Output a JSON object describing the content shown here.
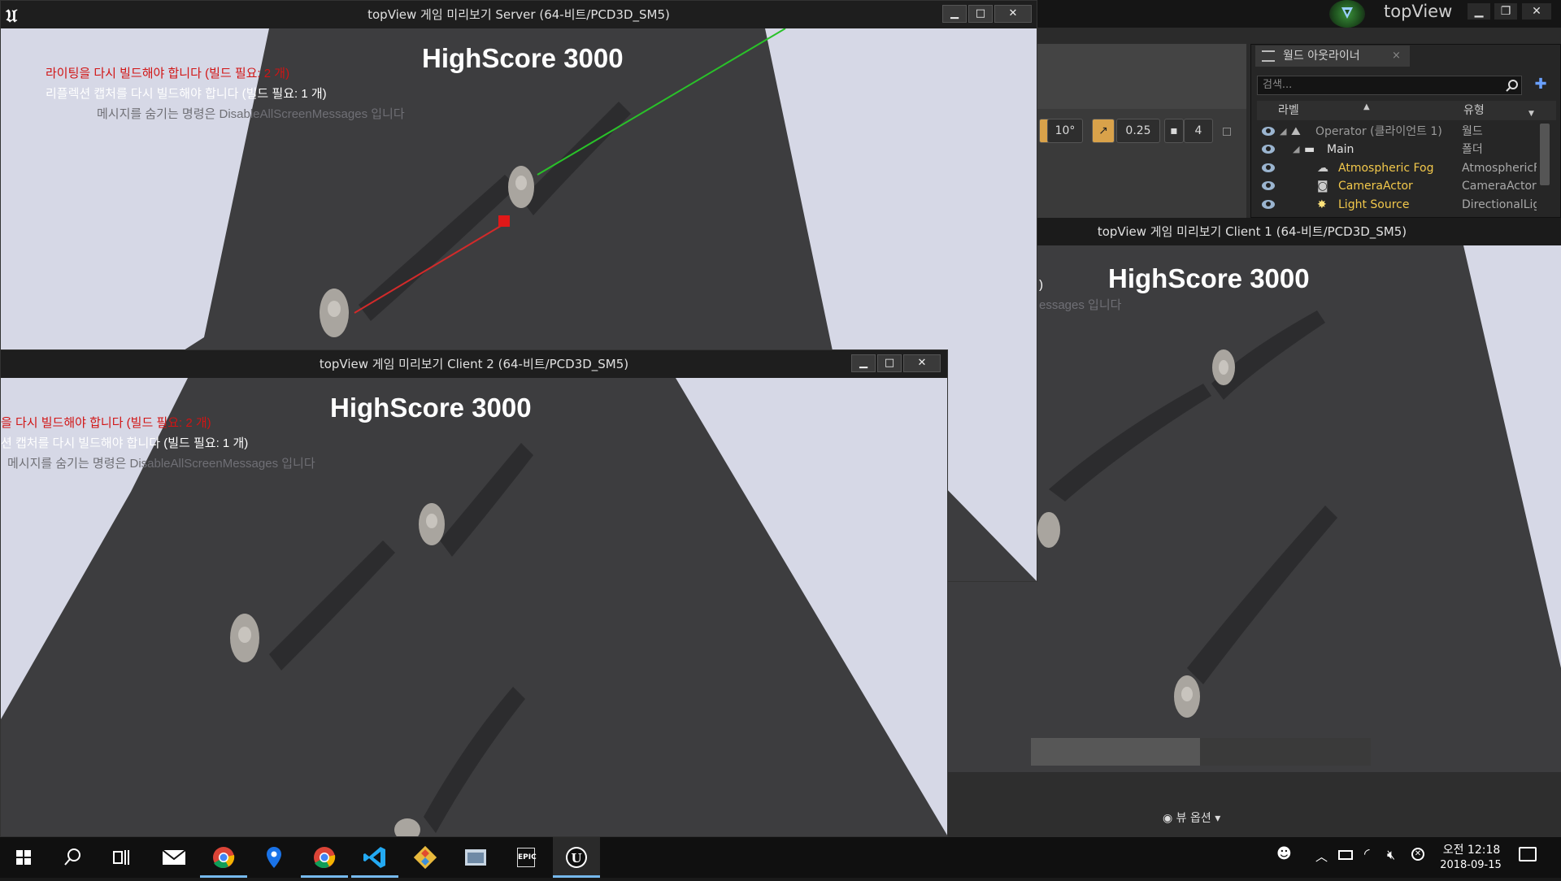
{
  "editor": {
    "app_name": "topView",
    "toolbar": {
      "rotation_snap": "10°",
      "scale_snap": "0.25",
      "camera_speed": "4"
    },
    "outliner": {
      "tab_label": "월드 아웃라이너",
      "search_placeholder": "검색...",
      "col_label": "라벨",
      "col_type": "유형",
      "rows": [
        {
          "label": "Operator (클라이언트 1)",
          "type": "월드",
          "color": "#9a9a9a"
        },
        {
          "label": "Main",
          "type": "폴더",
          "color": "#e0e0e0"
        },
        {
          "label": "Atmospheric Fog",
          "type": "AtmosphericF",
          "color": "#f2c84b"
        },
        {
          "label": "CameraActor",
          "type": "CameraActor",
          "color": "#f2c84b"
        },
        {
          "label": "Light Source",
          "type": "DirectionalLig",
          "color": "#f2c84b"
        }
      ]
    },
    "view_options": "뷰 옵션"
  },
  "server": {
    "title": "topView 게임 미리보기 Server (64-비트/PCD3D_SM5)",
    "score": "HighScore 3000",
    "msg_red": "라이팅을 다시 빌드해야 합니다 (빌드 필요: 2 개)",
    "msg_white": "리플렉션 캡처를 다시 빌드해야 합니다 (빌드 필요: 1 개)",
    "msg_gray": "메시지를 숨기는 명령은 DisableAllScreenMessages 입니다"
  },
  "client1": {
    "title": "topView 게임 미리보기 Client 1 (64-비트/PCD3D_SM5)",
    "score": "HighScore 3000",
    "msg_white": ")",
    "msg_gray": "essages 입니다"
  },
  "client2": {
    "title": "topView 게임 미리보기 Client 2 (64-비트/PCD3D_SM5)",
    "score": "HighScore 3000",
    "msg_red": "을 다시 빌드해야 합니다 (빌드 필요: 2 개)",
    "msg_white": "션 캡처를 다시 빌드해야 합니다 (빌드 필요: 1 개)",
    "msg_gray": "메시지를 숨기는 명령은 DisableAllScreenMessages 입니다"
  },
  "taskbar": {
    "time": "오전 12:18",
    "date": "2018-09-15",
    "apps": [
      "start-icon",
      "search-icon",
      "task-view-icon",
      "mail-icon",
      "chrome-icon",
      "maps-icon",
      "chrome-icon",
      "vscode-icon",
      "git-icon",
      "explorer-icon",
      "epic-games-icon",
      "unreal-engine-icon"
    ],
    "epic_label": "EPIC"
  },
  "colors": {
    "scene_floor": "#3d3d3f",
    "scene_bg": "#d6d8e6",
    "error_text": "#d11414",
    "actor_text": "#f2c84b",
    "highlight": "#76b9ed"
  }
}
